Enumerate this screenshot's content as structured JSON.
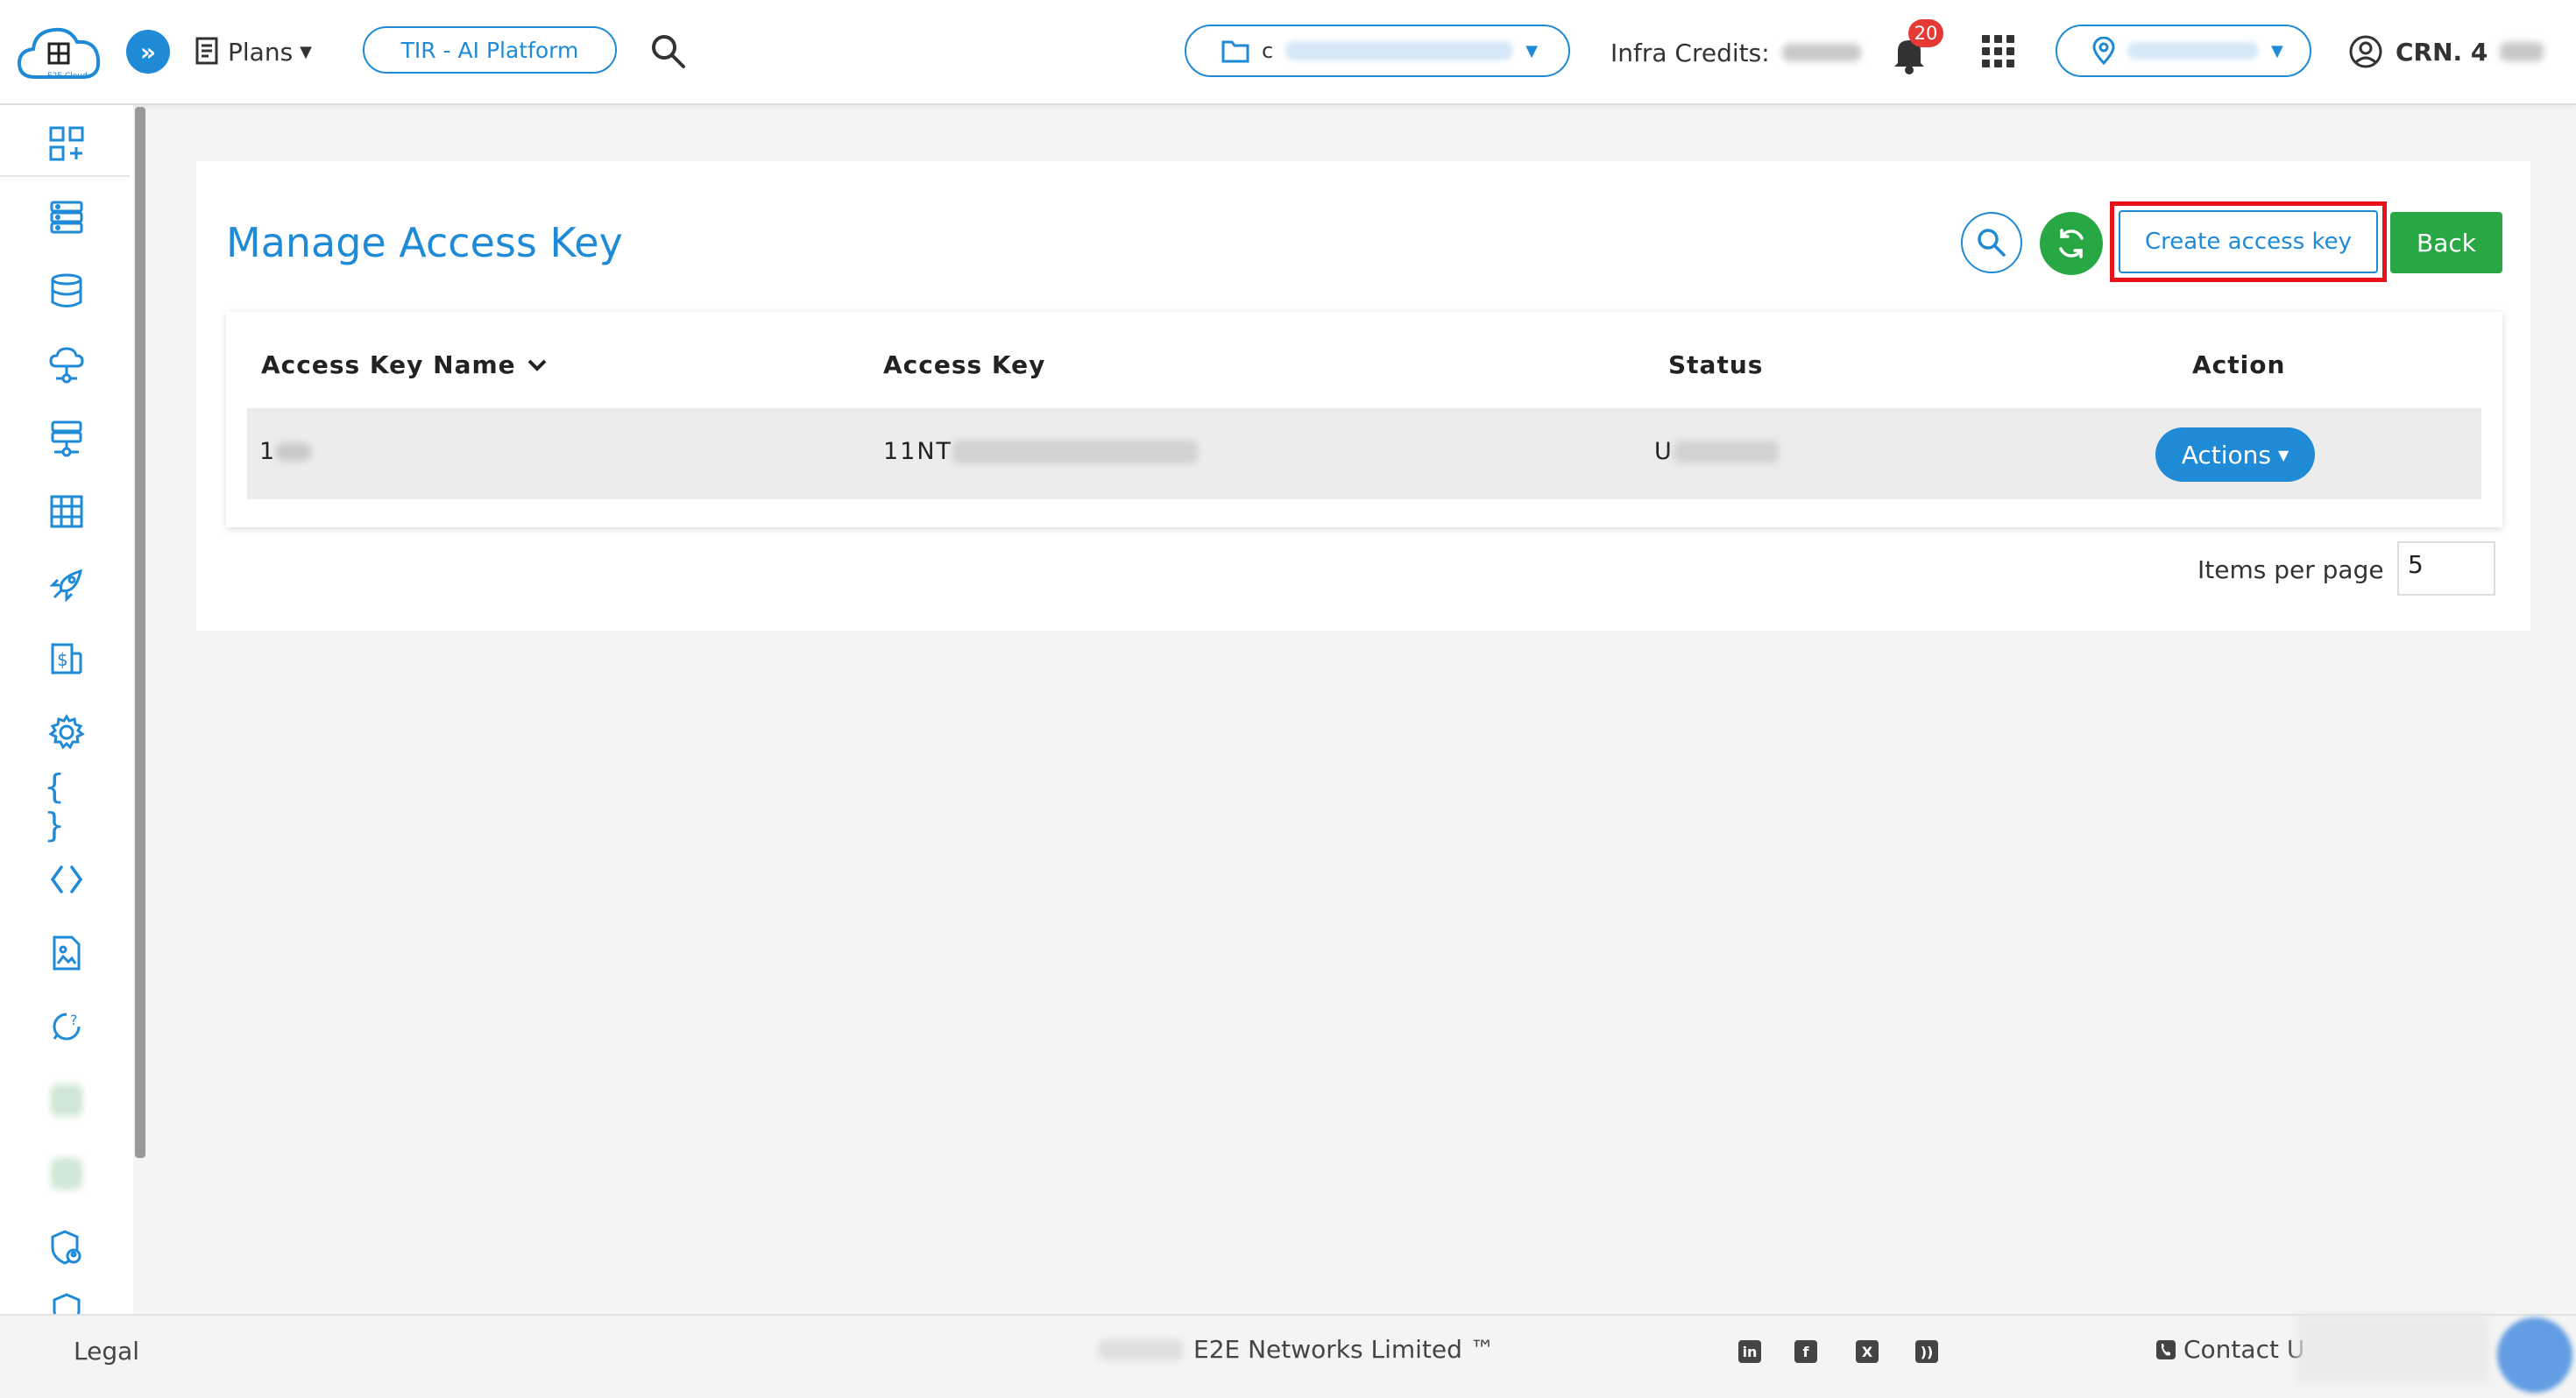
{
  "header": {
    "logo_text": "E2E Cloud",
    "plans_label": "Plans",
    "tir_label": "TIR - AI Platform",
    "project_prefix": "c",
    "infra_label": "Infra Credits:",
    "notification_count": "20",
    "crn_label": "CRN. 4"
  },
  "sidebar": {
    "items": [
      "dashboard-icon",
      "server-icon",
      "database-icon",
      "cloud-network-icon",
      "network-icon",
      "grid-table-icon",
      "rocket-icon",
      "billing-icon",
      "settings-icon",
      "code-braces-icon",
      "code-icon",
      "document-image-icon",
      "chat-refresh-icon",
      "blurred-icon",
      "blurred-icon",
      "shield-user-icon",
      "shield-icon"
    ]
  },
  "page": {
    "title": "Manage Access Key",
    "create_label": "Create access key",
    "back_label": "Back"
  },
  "table": {
    "headers": [
      "Access Key Name",
      "Access Key",
      "Status",
      "Action"
    ],
    "rows": [
      {
        "name": "1",
        "access_key": "11NT",
        "status": "U",
        "action": "Actions"
      }
    ]
  },
  "pagination": {
    "items_per_page_label": "Items per page",
    "items_per_page_value": "5"
  },
  "footer": {
    "legal": "Legal",
    "copyright": "E2E Networks Limited ™",
    "contact": "Contact U"
  },
  "colors": {
    "primary": "#1f8ad6",
    "success": "#27a844",
    "highlight": "#e8121b",
    "badge": "#e53935"
  }
}
